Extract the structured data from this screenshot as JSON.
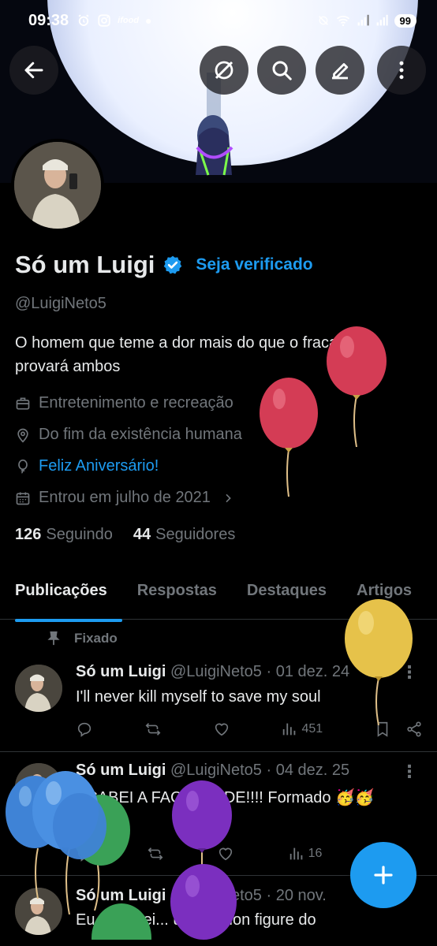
{
  "status_bar": {
    "time": "09:38",
    "left_icons": [
      "alarm-icon",
      "instagram-icon",
      "ifood-icon",
      "dot"
    ],
    "ifood_label": "ifood",
    "battery": "99"
  },
  "toolbar": {
    "back_icon": "arrow-left-icon",
    "grok_icon": "grok-icon",
    "search_icon": "search-icon",
    "compose_icon": "edit-icon",
    "more_icon": "more-vertical-icon"
  },
  "profile": {
    "name": "Só um Luigi",
    "verify_cta": "Seja verificado",
    "handle": "@LuigiNeto5",
    "bio_line1": "O homem que teme a dor mais do que o fracasso",
    "bio_line2": "provará ambos",
    "category": "Entretenimento e recreação",
    "location": "Do fim da existência humana",
    "birthday": "Feliz Aniversário!",
    "joined": "Entrou em julho de 2021",
    "following_count": "126",
    "following_label": "Seguindo",
    "followers_count": "44",
    "followers_label": "Seguidores"
  },
  "tabs": [
    {
      "label": "Publicações",
      "active": true
    },
    {
      "label": "Respostas",
      "active": false
    },
    {
      "label": "Destaques",
      "active": false
    },
    {
      "label": "Artigos",
      "active": false
    }
  ],
  "pinned_label": "Fixado",
  "tweets": [
    {
      "name": "Só um Luigi",
      "meta": "@LuigiNeto5 · 01 dez. 24",
      "text": "I'll never kill myself to save my soul",
      "views": "451"
    },
    {
      "name": "Só um Luigi",
      "meta": "@LuigiNeto5 · 04 dez. 25",
      "text": "ACABEI A FACULDADE!!!! Formado 🥳🥳",
      "text2": "🥳",
      "views": "16"
    },
    {
      "name": "Só um Luigi",
      "meta": "@LuigiNeto5 · 20 nov.",
      "text": "Eu comprei... uma action figure do"
    }
  ],
  "fab": {
    "icon": "plus-icon"
  },
  "colors": {
    "accent": "#1d9bf0",
    "muted": "#71767b",
    "text": "#e7e9ea",
    "bg": "#000000"
  }
}
